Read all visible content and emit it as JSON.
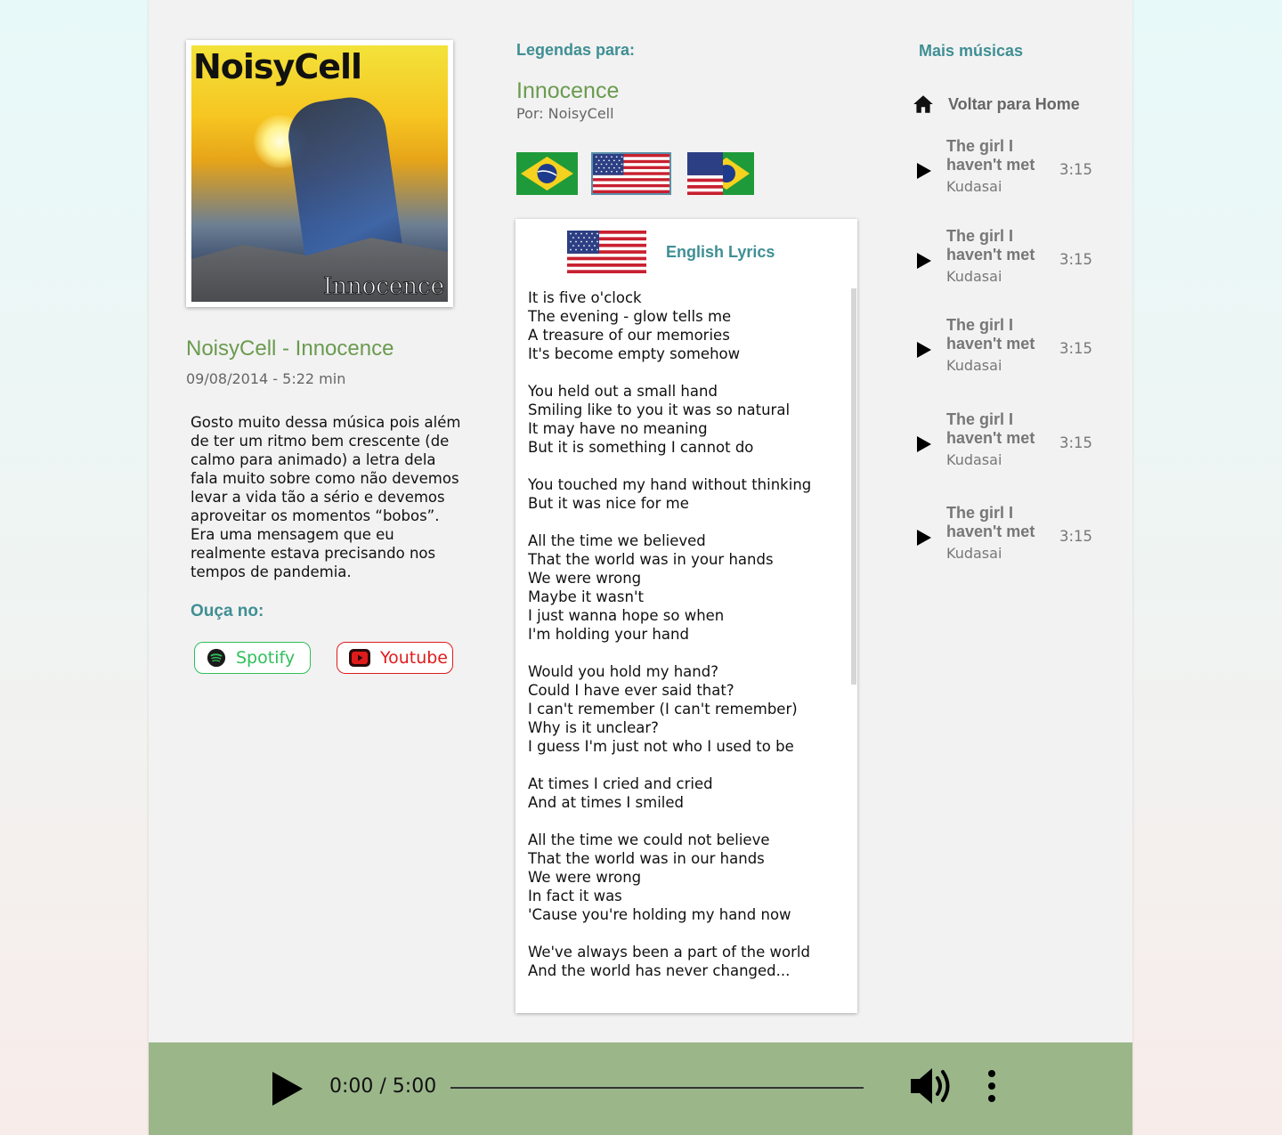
{
  "album": {
    "cover_logo_text": "NoisyCell",
    "cover_subtitle_text": "Innocence"
  },
  "song": {
    "heading": "NoisyCell - Innocence",
    "meta": "09/08/2014 - 5:22 min",
    "description": "Gosto muito dessa música pois além de ter um ritmo bem crescente (de calmo para animado) a letra dela fala muito sobre como não devemos levar a vida tão a sério e devemos aproveitar os momentos “bobos”. Era uma mensagem que eu realmente estava precisando nos tempos de pandemia.",
    "listen_label": "Ouça no:",
    "spotify_label": "Spotify",
    "youtube_label": "Youtube"
  },
  "subtitles": {
    "label": "Legendas para:",
    "title": "Innocence",
    "by": "Por: NoisyCell",
    "selected_language": "English Lyrics"
  },
  "lyrics": [
    [
      "It is five o'clock",
      "The evening - glow tells me",
      "A treasure of our memories",
      "It's become empty somehow"
    ],
    [
      "You held out a small hand",
      "Smiling like to you it was so natural",
      "It may have no meaning",
      "But it is something I cannot do"
    ],
    [
      "You touched my hand without thinking",
      "But it was nice for me"
    ],
    [
      "All the time we believed",
      "That the world was in your hands",
      "We were wrong",
      "Maybe it wasn't",
      "I just wanna hope so when",
      "I'm holding your hand"
    ],
    [
      "Would you hold my hand?",
      "Could I have ever said that?",
      "I can't remember (I can't remember)",
      "Why is it unclear?",
      "I guess I'm just not who I used to be"
    ],
    [
      "At times I cried and cried",
      "And at times I smiled"
    ],
    [
      "All the time we could not believe",
      "That the world was in our hands",
      "We were wrong",
      "In fact it was",
      "'Cause you're holding my hand now"
    ],
    [
      "We've always been a part of the world",
      "And the world has never changed..."
    ]
  ],
  "sidebar": {
    "title": "Mais músicas",
    "home_label": "Voltar para Home",
    "tracks": [
      {
        "title": "The girl I haven't met",
        "artist": "Kudasai",
        "duration": "3:15"
      },
      {
        "title": "The girl I haven't met",
        "artist": "Kudasai",
        "duration": "3:15"
      },
      {
        "title": "The girl I haven't met",
        "artist": "Kudasai",
        "duration": "3:15"
      },
      {
        "title": "The girl I haven't met",
        "artist": "Kudasai",
        "duration": "3:15"
      },
      {
        "title": "The girl I haven't met",
        "artist": "Kudasai",
        "duration": "3:15"
      }
    ]
  },
  "player": {
    "time": "0:00 / 5:00",
    "progress": 0
  },
  "colors": {
    "accent_teal": "#3f8f94",
    "accent_green": "#6a9b4f",
    "player_bar": "#9bb78a",
    "spotify": "#2fbf5a",
    "youtube": "#e01b1b"
  },
  "icons": {
    "home": "home-icon",
    "play": "play-icon",
    "volume": "volume-icon",
    "more": "more-vertical-icon",
    "spotify": "spotify-icon",
    "youtube": "youtube-icon"
  }
}
